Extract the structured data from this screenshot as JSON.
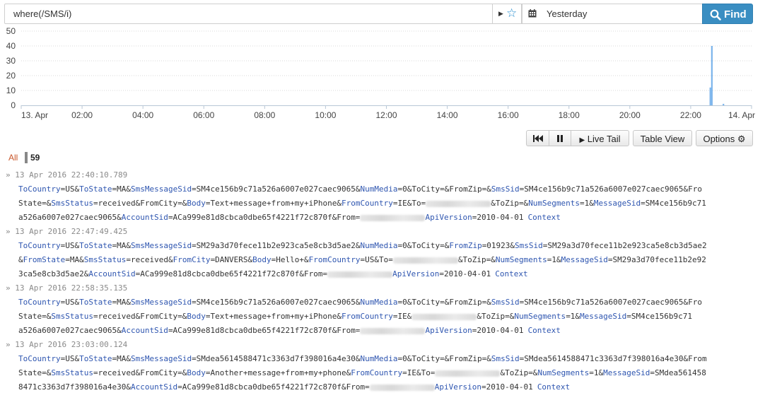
{
  "search": {
    "query": "where(/SMS/i)",
    "date_range": "Yesterday",
    "find_label": "Find"
  },
  "chart_data": {
    "type": "bar",
    "ylim": [
      0,
      50
    ],
    "yticks": [
      0,
      10,
      20,
      30,
      40,
      50
    ],
    "xtick_labels": [
      "13. Apr",
      "02:00",
      "04:00",
      "06:00",
      "08:00",
      "10:00",
      "12:00",
      "14:00",
      "16:00",
      "18:00",
      "20:00",
      "22:00",
      "14. Apr"
    ],
    "x_hours": [
      0,
      2,
      4,
      6,
      8,
      10,
      12,
      14,
      16,
      18,
      20,
      22,
      24
    ],
    "bars": [
      {
        "hour": 22.62,
        "value": 12
      },
      {
        "hour": 22.67,
        "value": 40
      },
      {
        "hour": 23.05,
        "value": 1
      }
    ],
    "bar_color": "#7cb5ec",
    "grid": true
  },
  "toolbar": {
    "live_tail_label": "Live Tail",
    "table_view_label": "Table View",
    "options_label": "Options"
  },
  "counts": {
    "all_label": "All",
    "total": "59"
  },
  "context_label": "Context",
  "entries": [
    {
      "timestamp": "» 13 Apr 2016 22:40:10.789",
      "lines": [
        [
          [
            "k",
            "ToCountry"
          ],
          [
            "v",
            "=US&"
          ],
          [
            "k",
            "ToState"
          ],
          [
            "v",
            "=MA&"
          ],
          [
            "k",
            "SmsMessageSid"
          ],
          [
            "v",
            "=SM4ce156b9c71a526a6007e027caec9065&"
          ],
          [
            "k",
            "NumMedia"
          ],
          [
            "v",
            "=0&ToCity=&FromZip=&"
          ],
          [
            "k",
            "SmsSid"
          ],
          [
            "v",
            "=SM4ce156b9c71a526a6007e027caec9065&Fro"
          ]
        ],
        [
          [
            "v",
            "State=&"
          ],
          [
            "k",
            "SmsStatus"
          ],
          [
            "v",
            "=received&FromCity=&"
          ],
          [
            "k",
            "Body"
          ],
          [
            "v",
            "=Text+message+from+my+iPhone&"
          ],
          [
            "k",
            "FromCountry"
          ],
          [
            "v",
            "=IE&To="
          ],
          [
            "b",
            ""
          ],
          [
            "v",
            "&ToZip=&"
          ],
          [
            "k",
            "NumSegments"
          ],
          [
            "v",
            "=1&"
          ],
          [
            "k",
            "MessageSid"
          ],
          [
            "v",
            "=SM4ce156b9c71"
          ]
        ],
        [
          [
            "v",
            "a526a6007e027caec9065&"
          ],
          [
            "k",
            "AccountSid"
          ],
          [
            "v",
            "=ACa999e81d8cbca0dbe65f4221f72c870f&From="
          ],
          [
            "b",
            ""
          ],
          [
            "k",
            "ApiVersion"
          ],
          [
            "v",
            "=2010-04-01"
          ],
          [
            "c",
            ""
          ]
        ]
      ]
    },
    {
      "timestamp": "» 13 Apr 2016 22:47:49.425",
      "lines": [
        [
          [
            "k",
            "ToCountry"
          ],
          [
            "v",
            "=US&"
          ],
          [
            "k",
            "ToState"
          ],
          [
            "v",
            "=MA&"
          ],
          [
            "k",
            "SmsMessageSid"
          ],
          [
            "v",
            "=SM29a3d70fece11b2e923ca5e8cb3d5ae2&"
          ],
          [
            "k",
            "NumMedia"
          ],
          [
            "v",
            "=0&ToCity=&"
          ],
          [
            "k",
            "FromZip"
          ],
          [
            "v",
            "=01923&"
          ],
          [
            "k",
            "SmsSid"
          ],
          [
            "v",
            "=SM29a3d70fece11b2e923ca5e8cb3d5ae2"
          ]
        ],
        [
          [
            "v",
            "&"
          ],
          [
            "k",
            "FromState"
          ],
          [
            "v",
            "=MA&"
          ],
          [
            "k",
            "SmsStatus"
          ],
          [
            "v",
            "=received&"
          ],
          [
            "k",
            "FromCity"
          ],
          [
            "v",
            "=DANVERS&"
          ],
          [
            "k",
            "Body"
          ],
          [
            "v",
            "=Hello+&"
          ],
          [
            "k",
            "FromCountry"
          ],
          [
            "v",
            "=US&To="
          ],
          [
            "b",
            ""
          ],
          [
            "v",
            "&ToZip=&"
          ],
          [
            "k",
            "NumSegments"
          ],
          [
            "v",
            "=1&"
          ],
          [
            "k",
            "MessageSid"
          ],
          [
            "v",
            "=SM29a3d70fece11b2e92"
          ]
        ],
        [
          [
            "v",
            "3ca5e8cb3d5ae2&"
          ],
          [
            "k",
            "AccountSid"
          ],
          [
            "v",
            "=ACa999e81d8cbca0dbe65f4221f72c870f&From="
          ],
          [
            "b",
            ""
          ],
          [
            "k",
            "ApiVersion"
          ],
          [
            "v",
            "=2010-04-01"
          ],
          [
            "c",
            ""
          ]
        ]
      ]
    },
    {
      "timestamp": "» 13 Apr 2016 22:58:35.135",
      "lines": [
        [
          [
            "k",
            "ToCountry"
          ],
          [
            "v",
            "=US&"
          ],
          [
            "k",
            "ToState"
          ],
          [
            "v",
            "=MA&"
          ],
          [
            "k",
            "SmsMessageSid"
          ],
          [
            "v",
            "=SM4ce156b9c71a526a6007e027caec9065&"
          ],
          [
            "k",
            "NumMedia"
          ],
          [
            "v",
            "=0&ToCity=&FromZip=&"
          ],
          [
            "k",
            "SmsSid"
          ],
          [
            "v",
            "=SM4ce156b9c71a526a6007e027caec9065&Fro"
          ]
        ],
        [
          [
            "v",
            "State=&"
          ],
          [
            "k",
            "SmsStatus"
          ],
          [
            "v",
            "=received&FromCity=&"
          ],
          [
            "k",
            "Body"
          ],
          [
            "v",
            "=Text+message+from+my+iPhone&"
          ],
          [
            "k",
            "FromCountry"
          ],
          [
            "v",
            "=IE&"
          ],
          [
            "b",
            ""
          ],
          [
            "v",
            "&ToZip=&"
          ],
          [
            "k",
            "NumSegments"
          ],
          [
            "v",
            "=1&"
          ],
          [
            "k",
            "MessageSid"
          ],
          [
            "v",
            "=SM4ce156b9c71"
          ]
        ],
        [
          [
            "v",
            "a526a6007e027caec9065&"
          ],
          [
            "k",
            "AccountSid"
          ],
          [
            "v",
            "=ACa999e81d8cbca0dbe65f4221f72c870f&From="
          ],
          [
            "b",
            ""
          ],
          [
            "k",
            "ApiVersion"
          ],
          [
            "v",
            "=2010-04-01"
          ],
          [
            "c",
            ""
          ]
        ]
      ]
    },
    {
      "timestamp": "» 13 Apr 2016 23:03:00.124",
      "lines": [
        [
          [
            "k",
            "ToCountry"
          ],
          [
            "v",
            "=US&"
          ],
          [
            "k",
            "ToState"
          ],
          [
            "v",
            "=MA&"
          ],
          [
            "k",
            "SmsMessageSid"
          ],
          [
            "v",
            "=SMdea5614588471c3363d7f398016a4e30&"
          ],
          [
            "k",
            "NumMedia"
          ],
          [
            "v",
            "=0&ToCity=&FromZip=&"
          ],
          [
            "k",
            "SmsSid"
          ],
          [
            "v",
            "=SMdea5614588471c3363d7f398016a4e30&From"
          ]
        ],
        [
          [
            "v",
            "State=&"
          ],
          [
            "k",
            "SmsStatus"
          ],
          [
            "v",
            "=received&FromCity=&"
          ],
          [
            "k",
            "Body"
          ],
          [
            "v",
            "=Another+message+from+my+phone&"
          ],
          [
            "k",
            "FromCountry"
          ],
          [
            "v",
            "=IE&To="
          ],
          [
            "b",
            ""
          ],
          [
            "v",
            "&ToZip=&"
          ],
          [
            "k",
            "NumSegments"
          ],
          [
            "v",
            "=1&"
          ],
          [
            "k",
            "MessageSid"
          ],
          [
            "v",
            "=SMdea561458"
          ]
        ],
        [
          [
            "v",
            "8471c3363d7f398016a4e30&"
          ],
          [
            "k",
            "AccountSid"
          ],
          [
            "v",
            "=ACa999e81d8cbca0dbe65f4221f72c870f&From="
          ],
          [
            "b",
            ""
          ],
          [
            "k",
            "ApiVersion"
          ],
          [
            "v",
            "=2010-04-01"
          ],
          [
            "c",
            ""
          ]
        ]
      ]
    }
  ]
}
